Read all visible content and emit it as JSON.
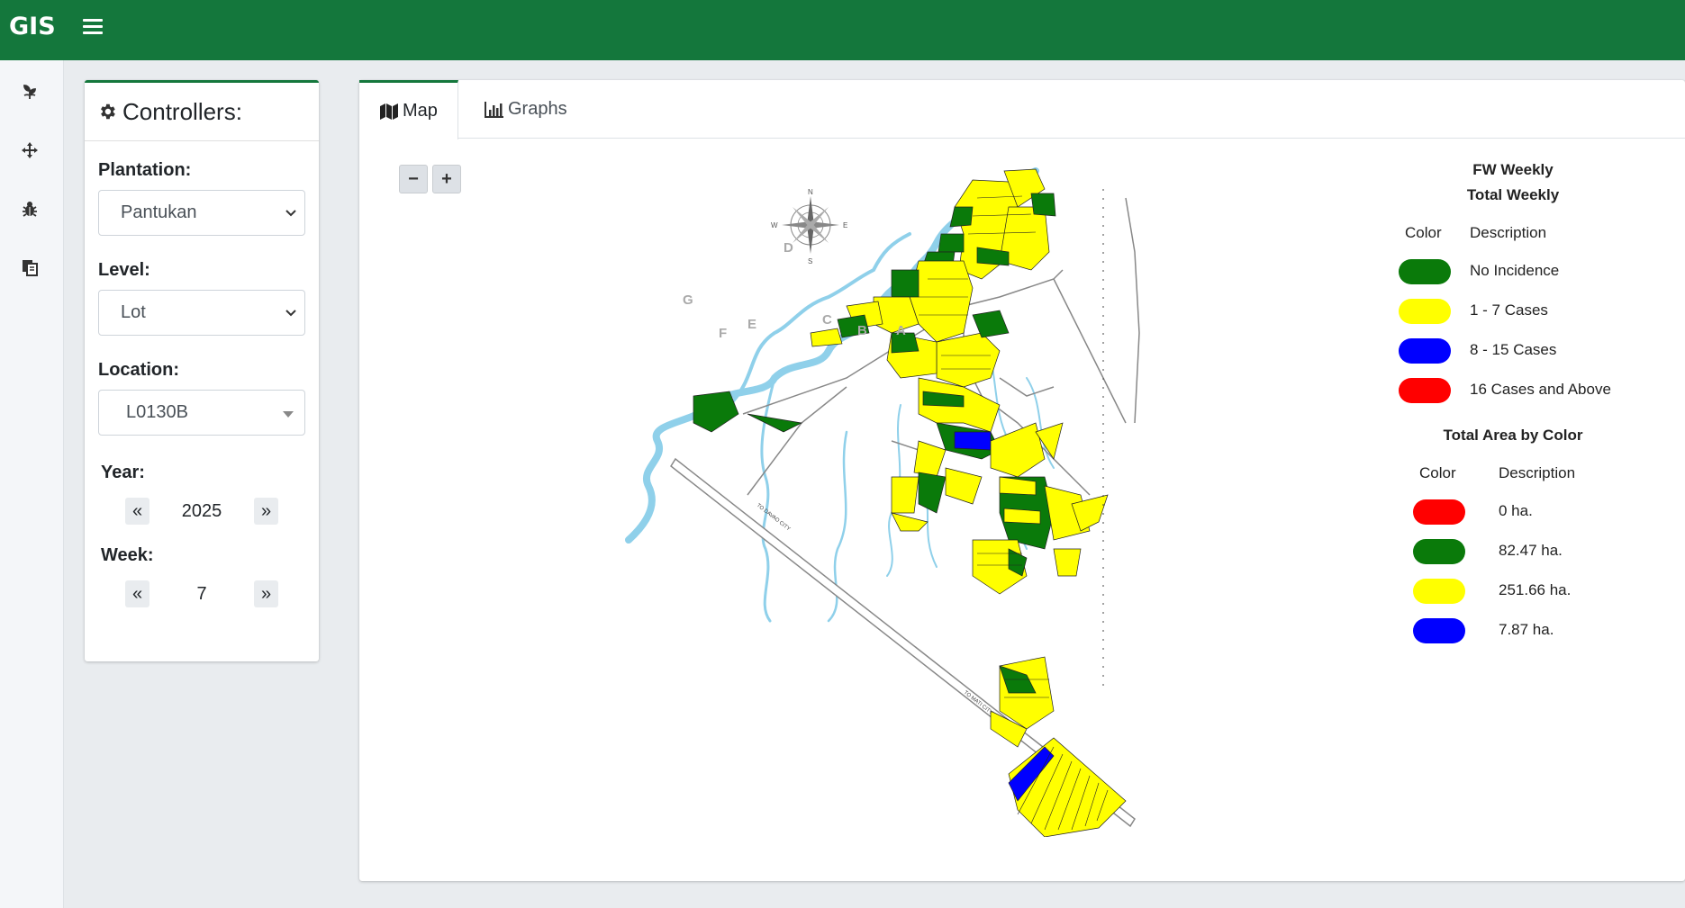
{
  "app": {
    "brand": "GIS"
  },
  "sidenav": {
    "icons": [
      "plant-icon",
      "crosshair-icon",
      "bug-icon",
      "reports-icon"
    ]
  },
  "controllers": {
    "title": "Controllers:",
    "plantation_label": "Plantation:",
    "plantation_value": "Pantukan",
    "level_label": "Level:",
    "level_value": "Lot",
    "location_label": "Location:",
    "location_value": "L0130B",
    "year_label": "Year:",
    "year_value": "2025",
    "week_label": "Week:",
    "week_value": "7",
    "prev": "«",
    "next": "»"
  },
  "tabs": {
    "map": "Map",
    "graphs": "Graphs"
  },
  "zoom": {
    "out": "−",
    "in": "+"
  },
  "map": {
    "compass": {
      "n": "N",
      "s": "S",
      "e": "E",
      "w": "W"
    },
    "block_letters": [
      "A",
      "B",
      "C",
      "D",
      "E",
      "F",
      "G"
    ],
    "road_label_1": "TO DAVAO CITY",
    "road_label_2": "TO MATI CITY"
  },
  "legend": {
    "title1": "FW Weekly",
    "title2": "Total Weekly",
    "color_header": "Color",
    "desc_header": "Description",
    "items": [
      {
        "color": "#0a7a0a",
        "label": "No Incidence"
      },
      {
        "color": "#ffff00",
        "label": "1 - 7 Cases"
      },
      {
        "color": "#0000ff",
        "label": "8 - 15 Cases"
      },
      {
        "color": "#ff0000",
        "label": "16 Cases and Above"
      }
    ],
    "area_title": "Total Area by Color",
    "area_items": [
      {
        "color": "#ff0000",
        "label": "0 ha."
      },
      {
        "color": "#0a7a0a",
        "label": "82.47 ha."
      },
      {
        "color": "#ffff00",
        "label": "251.66 ha."
      },
      {
        "color": "#0000ff",
        "label": "7.87 ha."
      }
    ]
  },
  "colors": {
    "brand_green": "#14773c",
    "river": "#8fd0ea"
  }
}
